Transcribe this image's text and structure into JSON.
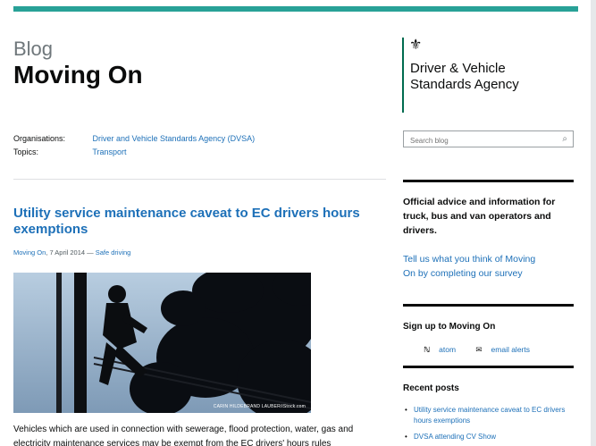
{
  "blog_label": "Blog",
  "page_title": "Moving On",
  "meta": {
    "organisations_label": "Organisations:",
    "organisations_value": "Driver and Vehicle Standards Agency (DVSA)",
    "topics_label": "Topics:",
    "topics_value": "Transport"
  },
  "post": {
    "title": "Utility service maintenance caveat to EC drivers hours exemptions",
    "blog_link": "Moving On",
    "date": ", 7 April 2014 — ",
    "category": "Safe driving",
    "photo_credit": "CARIN HILDEBRAND LAUBER/iStock.com",
    "body": "Vehicles which are used in connection with sewerage, flood protection, water, gas and electricity maintenance services may be exempt from the EC drivers' hours rules"
  },
  "sidebar": {
    "logo_text": "Driver & Vehicle Standards Agency",
    "search_placeholder": "Search blog",
    "advice": "Official advice and information for truck, bus and van operators and drivers.",
    "survey_text": "Tell us what you think of Moving On by completing our survey",
    "signup_title": "Sign up to Moving On",
    "feed_atom": "atom",
    "feed_email": "email alerts",
    "recent_title": "Recent posts",
    "recent_posts": [
      "Utility service maintenance caveat to EC drivers hours exemptions",
      "DVSA attending CV Show"
    ]
  },
  "colors": {
    "top_bar": "#28a197",
    "link": "#1d70b8",
    "logo_bar": "#006b4f"
  },
  "icons": {
    "crest": "royal-crest-icon",
    "search": "search-icon",
    "atom": "rss-icon",
    "email": "envelope-icon"
  }
}
